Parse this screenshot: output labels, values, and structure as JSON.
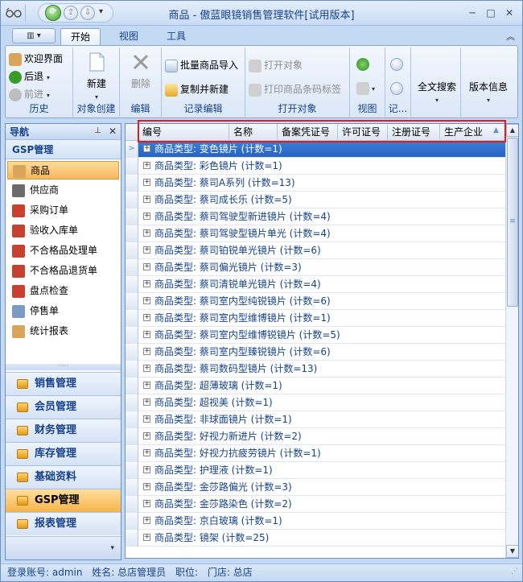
{
  "window": {
    "title": "商品 - 傲蓝眼镜销售管理软件[试用版本]",
    "min": "─",
    "max": "□",
    "close": "✕"
  },
  "qat": {
    "more": "▾"
  },
  "ribbon_tabs": [
    "开始",
    "视图",
    "工具"
  ],
  "ribbon": {
    "history": {
      "label": "历史",
      "welcome": "欢迎界面",
      "back": "后退",
      "forward": "前进"
    },
    "create": {
      "label": "对象创建",
      "new": "新建"
    },
    "edit": {
      "label": "编辑",
      "delete": "删除"
    },
    "record": {
      "label": "记录编辑",
      "batch_import": "批量商品导入",
      "copy_new": "复制并新建"
    },
    "open": {
      "label": "打开对象",
      "open_obj": "打开对象",
      "print_barcode": "打印商品条码标签"
    },
    "view": {
      "label": "视图"
    },
    "records": {
      "label": "记..."
    },
    "search": {
      "label": "全文搜索"
    },
    "version": {
      "label": "版本信息"
    }
  },
  "nav": {
    "title": "导航",
    "group_title": "GSP管理",
    "items": [
      {
        "label": "商品",
        "icon": "product-icon",
        "color": "#d9a55a"
      },
      {
        "label": "供应商",
        "icon": "supplier-icon",
        "color": "#6b6b6b"
      },
      {
        "label": "采购订单",
        "icon": "purchase-order-icon",
        "color": "#c8402e"
      },
      {
        "label": "验收入库单",
        "icon": "receipt-icon",
        "color": "#c8402e"
      },
      {
        "label": "不合格品处理单",
        "icon": "defect-process-icon",
        "color": "#c8402e"
      },
      {
        "label": "不合格品退货单",
        "icon": "defect-return-icon",
        "color": "#c8402e"
      },
      {
        "label": "盘点检查",
        "icon": "inventory-check-icon",
        "color": "#c8402e"
      },
      {
        "label": "停售单",
        "icon": "stop-sale-icon",
        "color": "#7a9bc4"
      },
      {
        "label": "统计报表",
        "icon": "report-icon",
        "color": "#d9a55a"
      }
    ],
    "groups": [
      {
        "label": "销售管理"
      },
      {
        "label": "会员管理"
      },
      {
        "label": "财务管理"
      },
      {
        "label": "库存管理"
      },
      {
        "label": "基础资料"
      },
      {
        "label": "GSP管理"
      },
      {
        "label": "报表管理"
      }
    ]
  },
  "grid": {
    "columns": [
      "编号",
      "名称",
      "备案凭证号",
      "许可证号",
      "注册证号",
      "生产企业"
    ],
    "rows": [
      "商品类型: 变色镜片 (计数=1)",
      "商品类型: 彩色镜片 (计数=1)",
      "商品类型: 蔡司A系列 (计数=13)",
      "商品类型: 蔡司成长乐 (计数=5)",
      "商品类型: 蔡司驾驶型新进镜片 (计数=4)",
      "商品类型: 蔡司驾驶型镜片单光 (计数=4)",
      "商品类型: 蔡司铂锐单光镜片 (计数=6)",
      "商品类型: 蔡司偏光镜片 (计数=3)",
      "商品类型: 蔡司清锐单光镜片 (计数=4)",
      "商品类型: 蔡司室内型纯锐镜片 (计数=6)",
      "商品类型: 蔡司室内型维博镜片 (计数=1)",
      "商品类型: 蔡司室内型维博锐镜片 (计数=5)",
      "商品类型: 蔡司室内型臻锐镜片 (计数=6)",
      "商品类型: 蔡司数码型镜片 (计数=13)",
      "商品类型: 超薄玻璃 (计数=1)",
      "商品类型: 超视美 (计数=1)",
      "商品类型: 非球面镜片 (计数=1)",
      "商品类型: 好视力新进片 (计数=2)",
      "商品类型: 好视力抗疲劳镜片 (计数=1)",
      "商品类型: 护理液 (计数=1)",
      "商品类型: 金莎路偏光 (计数=3)",
      "商品类型: 金莎路染色 (计数=2)",
      "商品类型: 京白玻璃 (计数=1)",
      "商品类型: 镜架 (计数=25)"
    ]
  },
  "status": {
    "account": "登录账号: admin",
    "name": "姓名: 总店管理员",
    "position": "职位:",
    "store": "门店: 总店"
  }
}
